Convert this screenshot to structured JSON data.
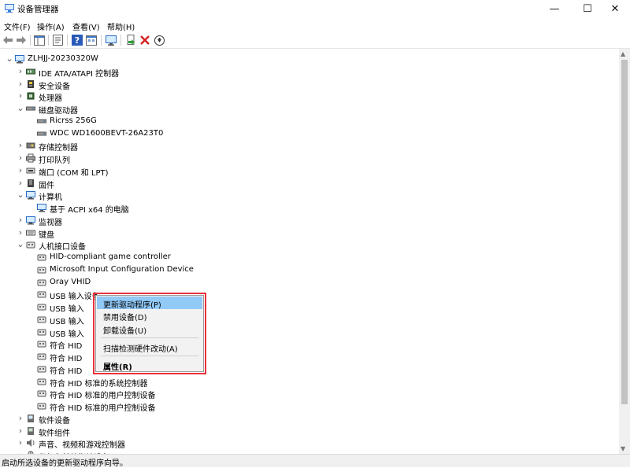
{
  "window": {
    "title": "设备管理器",
    "minimize": "—",
    "maximize": "☐",
    "close": "✕"
  },
  "menu": [
    "文件(F)",
    "操作(A)",
    "查看(V)",
    "帮助(H)"
  ],
  "toolbar": {
    "icons": [
      "back-icon",
      "forward-icon",
      "show-hide-tree-icon",
      "properties-icon",
      "help-icon",
      "view-icon",
      "monitor-icon",
      "update-driver-icon",
      "uninstall-icon",
      "download-icon"
    ]
  },
  "tree": {
    "root": "ZLHJJ-20230320W",
    "rows": [
      {
        "label": "ZLHJJ-20230320W",
        "level": 0,
        "state": "expanded",
        "icon": "computer-icon"
      },
      {
        "label": "IDE ATA/ATAPI 控制器",
        "level": 1,
        "state": "collapsed",
        "icon": "ide-controller-icon"
      },
      {
        "label": "安全设备",
        "level": 1,
        "state": "collapsed",
        "icon": "security-device-icon"
      },
      {
        "label": "处理器",
        "level": 1,
        "state": "collapsed",
        "icon": "processor-icon"
      },
      {
        "label": "磁盘驱动器",
        "level": 1,
        "state": "expanded",
        "icon": "disk-drive-icon"
      },
      {
        "label": "Ricrss 256G",
        "level": 2,
        "state": "leaf",
        "icon": "disk-icon"
      },
      {
        "label": "WDC WD1600BEVT-26A23T0",
        "level": 2,
        "state": "leaf",
        "icon": "disk-icon"
      },
      {
        "label": "存储控制器",
        "level": 1,
        "state": "collapsed",
        "icon": "storage-controller-icon"
      },
      {
        "label": "打印队列",
        "level": 1,
        "state": "collapsed",
        "icon": "printer-icon"
      },
      {
        "label": "端口 (COM 和 LPT)",
        "level": 1,
        "state": "collapsed",
        "icon": "port-icon"
      },
      {
        "label": "固件",
        "level": 1,
        "state": "collapsed",
        "icon": "firmware-icon"
      },
      {
        "label": "计算机",
        "level": 1,
        "state": "expanded",
        "icon": "monitor-icon"
      },
      {
        "label": "基于 ACPI x64 的电脑",
        "level": 2,
        "state": "leaf",
        "icon": "monitor-icon"
      },
      {
        "label": "监视器",
        "level": 1,
        "state": "collapsed",
        "icon": "monitor-icon"
      },
      {
        "label": "键盘",
        "level": 1,
        "state": "collapsed",
        "icon": "keyboard-icon"
      },
      {
        "label": "人机接口设备",
        "level": 1,
        "state": "expanded",
        "icon": "hid-icon"
      },
      {
        "label": "HID-compliant game controller",
        "level": 2,
        "state": "leaf",
        "icon": "hid-icon"
      },
      {
        "label": "Microsoft Input Configuration Device",
        "level": 2,
        "state": "leaf",
        "icon": "hid-icon"
      },
      {
        "label": "Oray VHID",
        "level": 2,
        "state": "leaf",
        "icon": "hid-icon"
      },
      {
        "label": "USB 输入设备",
        "level": 2,
        "state": "leaf",
        "icon": "hid-icon"
      },
      {
        "label": "USB 输入",
        "level": 2,
        "state": "leaf",
        "icon": "hid-icon"
      },
      {
        "label": "USB 输入",
        "level": 2,
        "state": "leaf",
        "icon": "hid-icon"
      },
      {
        "label": "USB 输入",
        "level": 2,
        "state": "leaf",
        "icon": "hid-icon"
      },
      {
        "label": "符合 HID",
        "level": 2,
        "state": "leaf",
        "icon": "hid-icon"
      },
      {
        "label": "符合 HID",
        "level": 2,
        "state": "leaf",
        "icon": "hid-icon"
      },
      {
        "label": "符合 HID",
        "level": 2,
        "state": "leaf",
        "icon": "hid-icon"
      },
      {
        "label": "符合 HID 标准的系统控制器",
        "level": 2,
        "state": "leaf",
        "icon": "hid-icon"
      },
      {
        "label": "符合 HID 标准的用户控制设备",
        "level": 2,
        "state": "leaf",
        "icon": "hid-icon"
      },
      {
        "label": "符合 HID 标准的用户控制设备",
        "level": 2,
        "state": "leaf",
        "icon": "hid-icon"
      },
      {
        "label": "软件设备",
        "level": 1,
        "state": "collapsed",
        "icon": "software-device-icon"
      },
      {
        "label": "软件组件",
        "level": 1,
        "state": "collapsed",
        "icon": "software-component-icon"
      },
      {
        "label": "声音、视频和游戏控制器",
        "level": 1,
        "state": "collapsed",
        "icon": "sound-icon"
      },
      {
        "label": "鼠标和其他指针设备",
        "level": 1,
        "state": "collapsed",
        "icon": "mouse-icon"
      }
    ]
  },
  "context_menu": {
    "items": [
      {
        "label": "更新驱动程序(P)",
        "selected": true,
        "bold": false
      },
      {
        "label": "禁用设备(D)",
        "selected": false,
        "bold": false
      },
      {
        "label": "卸载设备(U)",
        "selected": false,
        "bold": false
      },
      {
        "label": "扫描检测硬件改动(A)",
        "selected": false,
        "bold": false
      },
      {
        "label": "属性(R)",
        "selected": false,
        "bold": true
      }
    ]
  },
  "status": "启动所选设备的更新驱动程序向导。",
  "colors": {
    "highlight_border": "#e8323a",
    "menu_selected": "#91c9f7",
    "menu_bg": "#f2f2f2"
  }
}
